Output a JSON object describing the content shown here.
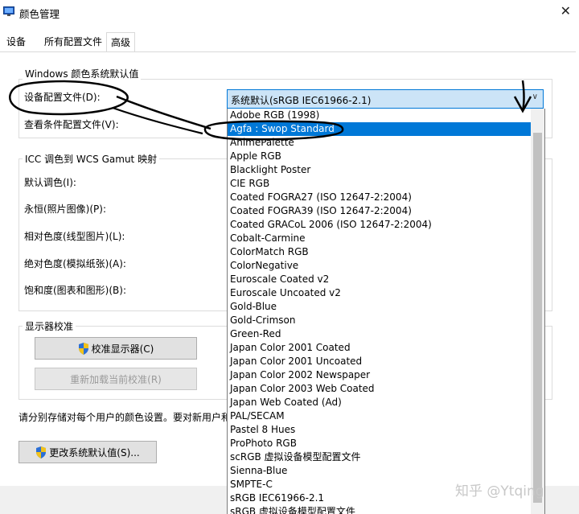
{
  "window": {
    "title": "颜色管理",
    "close_glyph": "✕"
  },
  "tabs": [
    {
      "label": "设备"
    },
    {
      "label": "所有配置文件"
    },
    {
      "label": "高级"
    }
  ],
  "defaults_group": {
    "legend": "Windows 颜色系统默认值",
    "device_profile_label": "设备配置文件(D):",
    "viewing_conditions_label": "查看条件配置文件(V):"
  },
  "icc_group": {
    "legend": "ICC 调色到 WCS Gamut 映射",
    "rows": [
      "默认调色(I):",
      "永恒(照片图像)(P):",
      "相对色度(线型图片)(L):",
      "绝对色度(模拟纸张)(A):",
      "饱和度(图表和图形)(B):"
    ]
  },
  "calibration_group": {
    "legend": "显示器校准",
    "calibrate_button": "校准显示器(C)",
    "reload_button": "重新加载当前校准(R)"
  },
  "note_text": "请分别存储对每个用户的颜色设置。要对新用户和",
  "change_defaults_button": "更改系统默认值(S)...",
  "combo": {
    "value": "系统默认(sRGB IEC61966-2.1)",
    "arrow": "∨"
  },
  "dropdown_items": [
    "Adobe RGB (1998)",
    "Agfa : Swop Standard",
    "AnimePalette",
    "Apple RGB",
    "Blacklight Poster",
    "CIE RGB",
    "Coated FOGRA27 (ISO 12647-2:2004)",
    "Coated FOGRA39 (ISO 12647-2:2004)",
    "Coated GRACoL 2006 (ISO 12647-2:2004)",
    "Cobalt-Carmine",
    "ColorMatch RGB",
    "ColorNegative",
    "Euroscale Coated v2",
    "Euroscale Uncoated v2",
    "Gold-Blue",
    "Gold-Crimson",
    "Green-Red",
    "Japan Color 2001 Coated",
    "Japan Color 2001 Uncoated",
    "Japan Color 2002 Newspaper",
    "Japan Color 2003 Web Coated",
    "Japan Web Coated (Ad)",
    "PAL/SECAM",
    "Pastel 8 Hues",
    "ProPhoto RGB",
    "scRGB 虚拟设备模型配置文件",
    "Sienna-Blue",
    "SMPTE-C",
    "sRGB IEC61966-2.1",
    "sRGB 虚拟设备模型配置文件"
  ],
  "selected_index": 1,
  "watermark": "知乎 @Ytqing",
  "colors": {
    "accent": "#0078d7",
    "selection_bg": "#0078d7",
    "combo_bg": "#cce4f7"
  }
}
